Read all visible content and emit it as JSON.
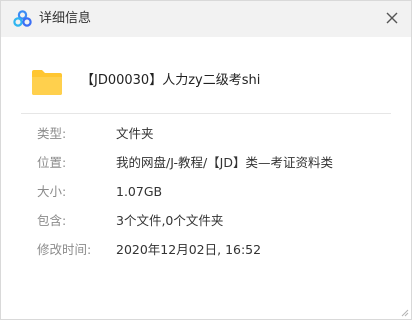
{
  "window": {
    "title": "详细信息",
    "icon": "baidu-netdisk-cloud-icon",
    "close_icon": "close-icon"
  },
  "file": {
    "icon": "folder-icon",
    "icon_color": "#ffc631",
    "name": "【JD00030】人力zy二级考shi"
  },
  "details": [
    {
      "label": "类型:",
      "value": "文件夹"
    },
    {
      "label": "位置:",
      "value": "我的网盘/J-教程/【JD】类—考证资料类"
    },
    {
      "label": "大小:",
      "value": "1.07GB"
    },
    {
      "label": "包含:",
      "value": "3个文件,0个文件夹"
    },
    {
      "label": "修改时间:",
      "value": "2020年12月02日, 16:52"
    }
  ],
  "colors": {
    "titlebar_bg": "#f2f2f2",
    "label_text": "#8c8c8c",
    "value_text": "#333333",
    "brand_blue": "#3b8cf5"
  }
}
